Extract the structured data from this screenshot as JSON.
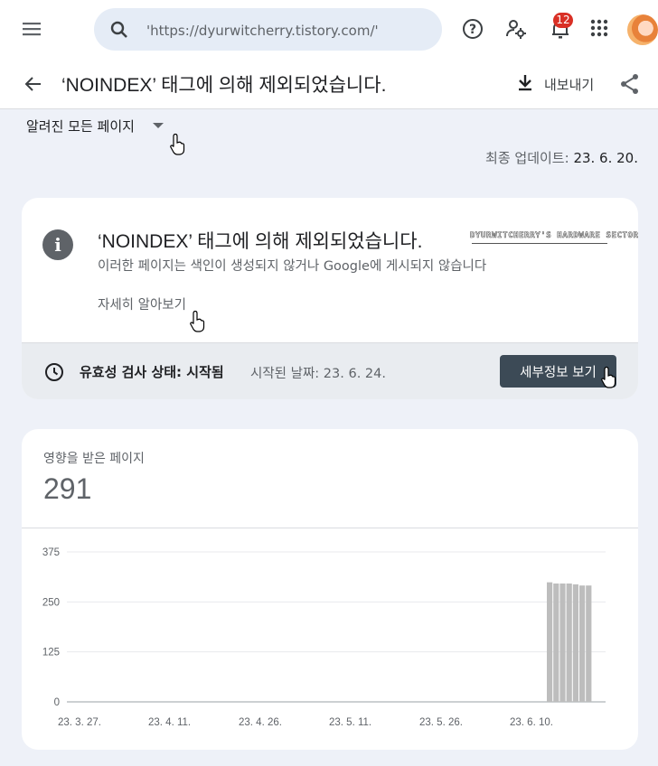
{
  "topbar": {
    "search": {
      "value": "'https://dyurwitcherry.tistory.com/'"
    },
    "notifications_count": "12"
  },
  "header": {
    "title": "‘NOINDEX’ 태그에 의해 제외되었습니다.",
    "export_label": "내보내기"
  },
  "filter": {
    "selected": "알려진 모든 페이지"
  },
  "last_updated": {
    "label": "최종 업데이트:",
    "value": "23. 6. 20."
  },
  "info_card": {
    "title": "‘NOINDEX’ 태그에 의해 제외되었습니다.",
    "description": "이러한 페이지는 색인이 생성되지 않거나 Google에 게시되지 않습니다",
    "learn_more": "자세히 알아보기",
    "watermark": "DYURWITCHERRY'S HARDWARE SECTOR",
    "validation": {
      "label": "유효성 검사 상태: 시작됨",
      "started": "시작된 날짜: 23. 6. 24.",
      "details_button": "세부정보 보기"
    }
  },
  "stats": {
    "label": "영향을 받은 페이지",
    "value": "291"
  },
  "colors": {
    "bar": "#bdbdbd",
    "accent_button": "#3c4a56",
    "badge": "#d93025"
  },
  "chart_data": {
    "type": "bar",
    "y_ticks": [
      "375",
      "250",
      "125",
      "0"
    ],
    "ylim": [
      0,
      375
    ],
    "x_ticks": [
      "23. 3. 27.",
      "23. 4. 11.",
      "23. 4. 26.",
      "23. 5. 11.",
      "23. 5. 26.",
      "23. 6. 10."
    ],
    "series": [
      {
        "values": [
          299,
          296,
          296,
          296,
          294,
          291,
          291
        ]
      }
    ]
  }
}
